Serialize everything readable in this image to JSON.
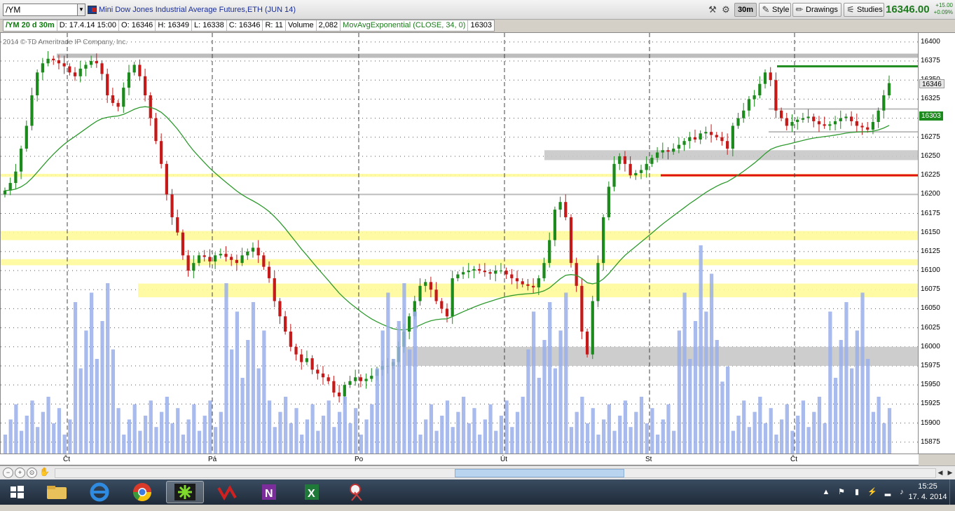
{
  "toolbar": {
    "symbol": "/YM",
    "description": "Mini Dow Jones Industrial Average Futures,ETH (JUN 14)",
    "interval": "30m",
    "style_label": "Style",
    "drawings_label": "Drawings",
    "studies_label": "Studies",
    "last_price": "16346.00",
    "change_abs": "+15.00",
    "change_pct": "+0.09%"
  },
  "infobar": {
    "title": "/YM 20 d 30m",
    "date": "D: 17.4.14 15:00",
    "open": "O: 16346",
    "high": "H: 16349",
    "low": "L: 16338",
    "close": "C: 16346",
    "range": "R: 11",
    "volume_label": "Volume",
    "volume_value": "2,082",
    "study": "MovAvgExponential (CLOSE, 34, 0)",
    "study_value": "16303"
  },
  "copyright": "2014 © TD Ameritrade IP Company, Inc.",
  "colors": {
    "up": "#1d8a1d",
    "down": "#c51a1a",
    "ema": "#2e9a2e",
    "volume": "#9aaeea",
    "zone_yellow": "#fffa9a",
    "zone_gray": "#c8c8c8",
    "resistance_green": "#1e8c1e",
    "support_red": "#e01010"
  },
  "price_axis": {
    "ticks": [
      "16400",
      "16375",
      "16350",
      "16325",
      "16300",
      "16275",
      "16250",
      "16225",
      "16200",
      "16175",
      "16150",
      "16125",
      "16100",
      "16075",
      "16050",
      "16025",
      "16000",
      "15975",
      "15950",
      "15925",
      "15900",
      "15875"
    ],
    "last_tag": "16346",
    "ema_tag": "16303"
  },
  "time_axis": {
    "labels": [
      "Čt",
      "Pá",
      "Po",
      "Út",
      "St",
      "Čt"
    ]
  },
  "taskbar": {
    "clock_time": "15:25",
    "clock_date": "17. 4. 2014",
    "apps": [
      "file-explorer",
      "internet-explorer",
      "chrome",
      "thinkorswim",
      "broker",
      "onenote",
      "excel",
      "snipping-tool"
    ]
  },
  "chart_data": {
    "type": "candlestick",
    "title": "/YM 20 d 30m",
    "ylabel": "",
    "ylim": [
      15860,
      16410
    ],
    "x_sessions": [
      "Čt",
      "Pá",
      "Po",
      "Út",
      "St",
      "Čt"
    ],
    "closes": [
      16205,
      16215,
      16230,
      16260,
      16290,
      16330,
      16360,
      16372,
      16378,
      16376,
      16372,
      16368,
      16360,
      16355,
      16365,
      16370,
      16375,
      16372,
      16358,
      16330,
      16320,
      16315,
      16340,
      16360,
      16370,
      16355,
      16330,
      16300,
      16270,
      16240,
      16200,
      16170,
      16150,
      16120,
      16100,
      16110,
      16120,
      16118,
      16112,
      16120,
      16122,
      16118,
      16114,
      16110,
      16120,
      16125,
      16130,
      16120,
      16105,
      16090,
      16060,
      16040,
      16020,
      16000,
      15990,
      15980,
      15985,
      15970,
      15965,
      15960,
      15955,
      15940,
      15935,
      15950,
      15955,
      15960,
      15955,
      15958,
      15962,
      15970,
      15975,
      15975,
      15980,
      16000,
      16020,
      16040,
      16060,
      16080,
      16085,
      16075,
      16060,
      16050,
      16040,
      16090,
      16095,
      16098,
      16100,
      16102,
      16100,
      16098,
      16096,
      16100,
      16100,
      16095,
      16090,
      16086,
      16082,
      16080,
      16078,
      16090,
      16110,
      16140,
      16180,
      16190,
      16170,
      16110,
      16080,
      16020,
      15990,
      16060,
      16110,
      16170,
      16210,
      16240,
      16250,
      16240,
      16225,
      16228,
      16232,
      16240,
      16248,
      16255,
      16258,
      16256,
      16260,
      16265,
      16270,
      16275,
      16272,
      16280,
      16282,
      16278,
      16275,
      16270,
      16260,
      16290,
      16300,
      16310,
      16325,
      16330,
      16345,
      16360,
      16350,
      16310,
      16300,
      16290,
      16295,
      16298,
      16300,
      16302,
      16296,
      16292,
      16290,
      16292,
      16296,
      16300,
      16302,
      16296,
      16290,
      16288,
      16285,
      16295,
      16310,
      16330,
      16346
    ],
    "ema_period": 34,
    "volume_ylim": [
      0,
      3000
    ],
    "horizontal_levels": [
      {
        "kind": "zone",
        "color": "yellow",
        "low": 16140,
        "high": 16152
      },
      {
        "kind": "zone",
        "color": "yellow",
        "low": 16107,
        "high": 16115
      },
      {
        "kind": "zone",
        "color": "yellow",
        "low": 16065,
        "high": 16083
      },
      {
        "kind": "zone",
        "color": "yellow",
        "low": 16223,
        "high": 16227
      },
      {
        "kind": "zone",
        "color": "gray",
        "low": 16245,
        "high": 16258
      },
      {
        "kind": "zone",
        "color": "gray",
        "low": 15975,
        "high": 16000
      },
      {
        "kind": "line",
        "color": "gray",
        "value": 16382
      },
      {
        "kind": "line",
        "color": "gray",
        "value": 16200
      },
      {
        "kind": "line",
        "color": "gray",
        "value": 16312
      },
      {
        "kind": "line",
        "color": "gray",
        "value": 16282
      },
      {
        "kind": "line",
        "color": "green",
        "value": 16368
      },
      {
        "kind": "line",
        "color": "red",
        "value": 16225
      }
    ]
  }
}
